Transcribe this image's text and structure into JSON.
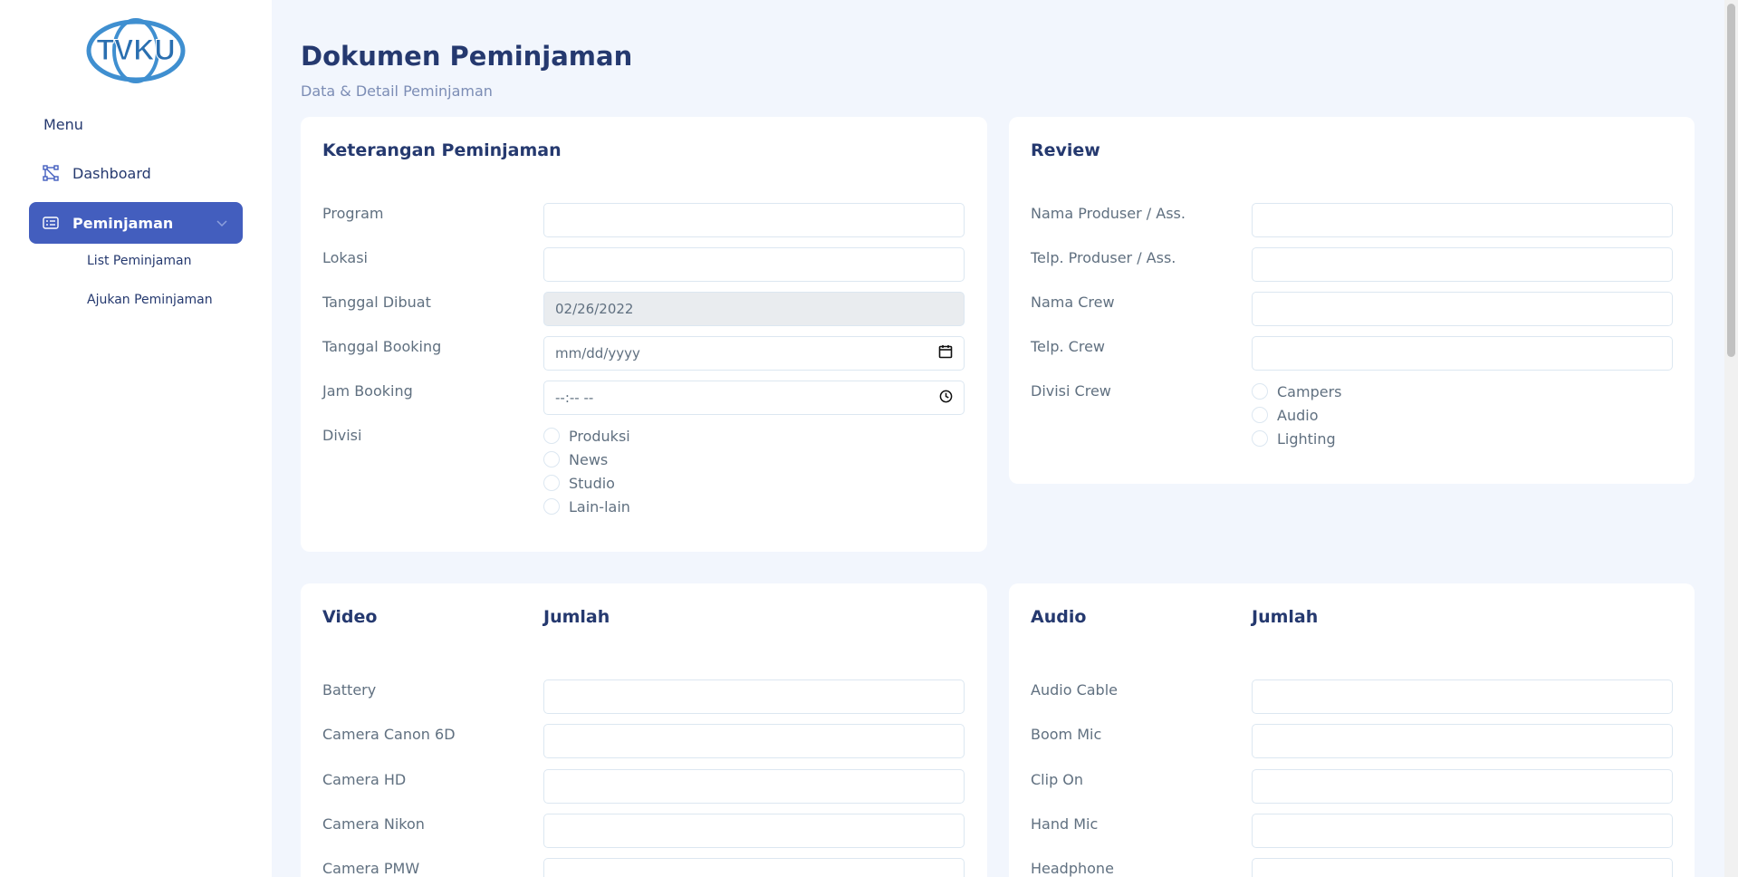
{
  "sidebar": {
    "logo_text": "TVKU",
    "menu_title": "Menu",
    "items": [
      {
        "label": "Dashboard",
        "icon": "grid-icon"
      },
      {
        "label": "Peminjaman",
        "icon": "list-card-icon",
        "active": true,
        "sub": [
          {
            "label": "List Peminjaman"
          },
          {
            "label": "Ajukan Peminjaman"
          }
        ]
      }
    ]
  },
  "header": {
    "title": "Dokumen Peminjaman",
    "subtitle": "Data & Detail Peminjaman"
  },
  "keterangan": {
    "title": "Keterangan Peminjaman",
    "fields": [
      {
        "label": "Program",
        "value": ""
      },
      {
        "label": "Lokasi",
        "value": ""
      },
      {
        "label": "Tanggal Dibuat",
        "value": "02/26/2022"
      },
      {
        "label": "Tanggal Booking",
        "value": "mm/dd/yyyy"
      },
      {
        "label": "Jam Booking",
        "value": "--:-- --"
      }
    ],
    "divisi_label": "Divisi",
    "divisi_options": [
      "Produksi",
      "News",
      "Studio",
      "Lain-lain"
    ]
  },
  "review": {
    "title": "Review",
    "fields": [
      {
        "label": "Nama Produser / Ass.",
        "value": ""
      },
      {
        "label": "Telp. Produser / Ass.",
        "value": ""
      },
      {
        "label": "Nama Crew",
        "value": ""
      },
      {
        "label": "Telp. Crew",
        "value": ""
      }
    ],
    "divisi_label": "Divisi Crew",
    "divisi_options": [
      "Campers",
      "Audio",
      "Lighting"
    ]
  },
  "video": {
    "title": "Video",
    "qty_title": "Jumlah",
    "items": [
      "Battery",
      "Camera Canon 6D",
      "Camera HD",
      "Camera Nikon",
      "Camera PMW"
    ]
  },
  "audio": {
    "title": "Audio",
    "qty_title": "Jumlah",
    "items": [
      "Audio Cable",
      "Boom Mic",
      "Clip On",
      "Hand Mic",
      "Headphone"
    ]
  },
  "colors": {
    "accent": "#435ebe",
    "text": "#25396f",
    "background": "#f2f6fd"
  }
}
